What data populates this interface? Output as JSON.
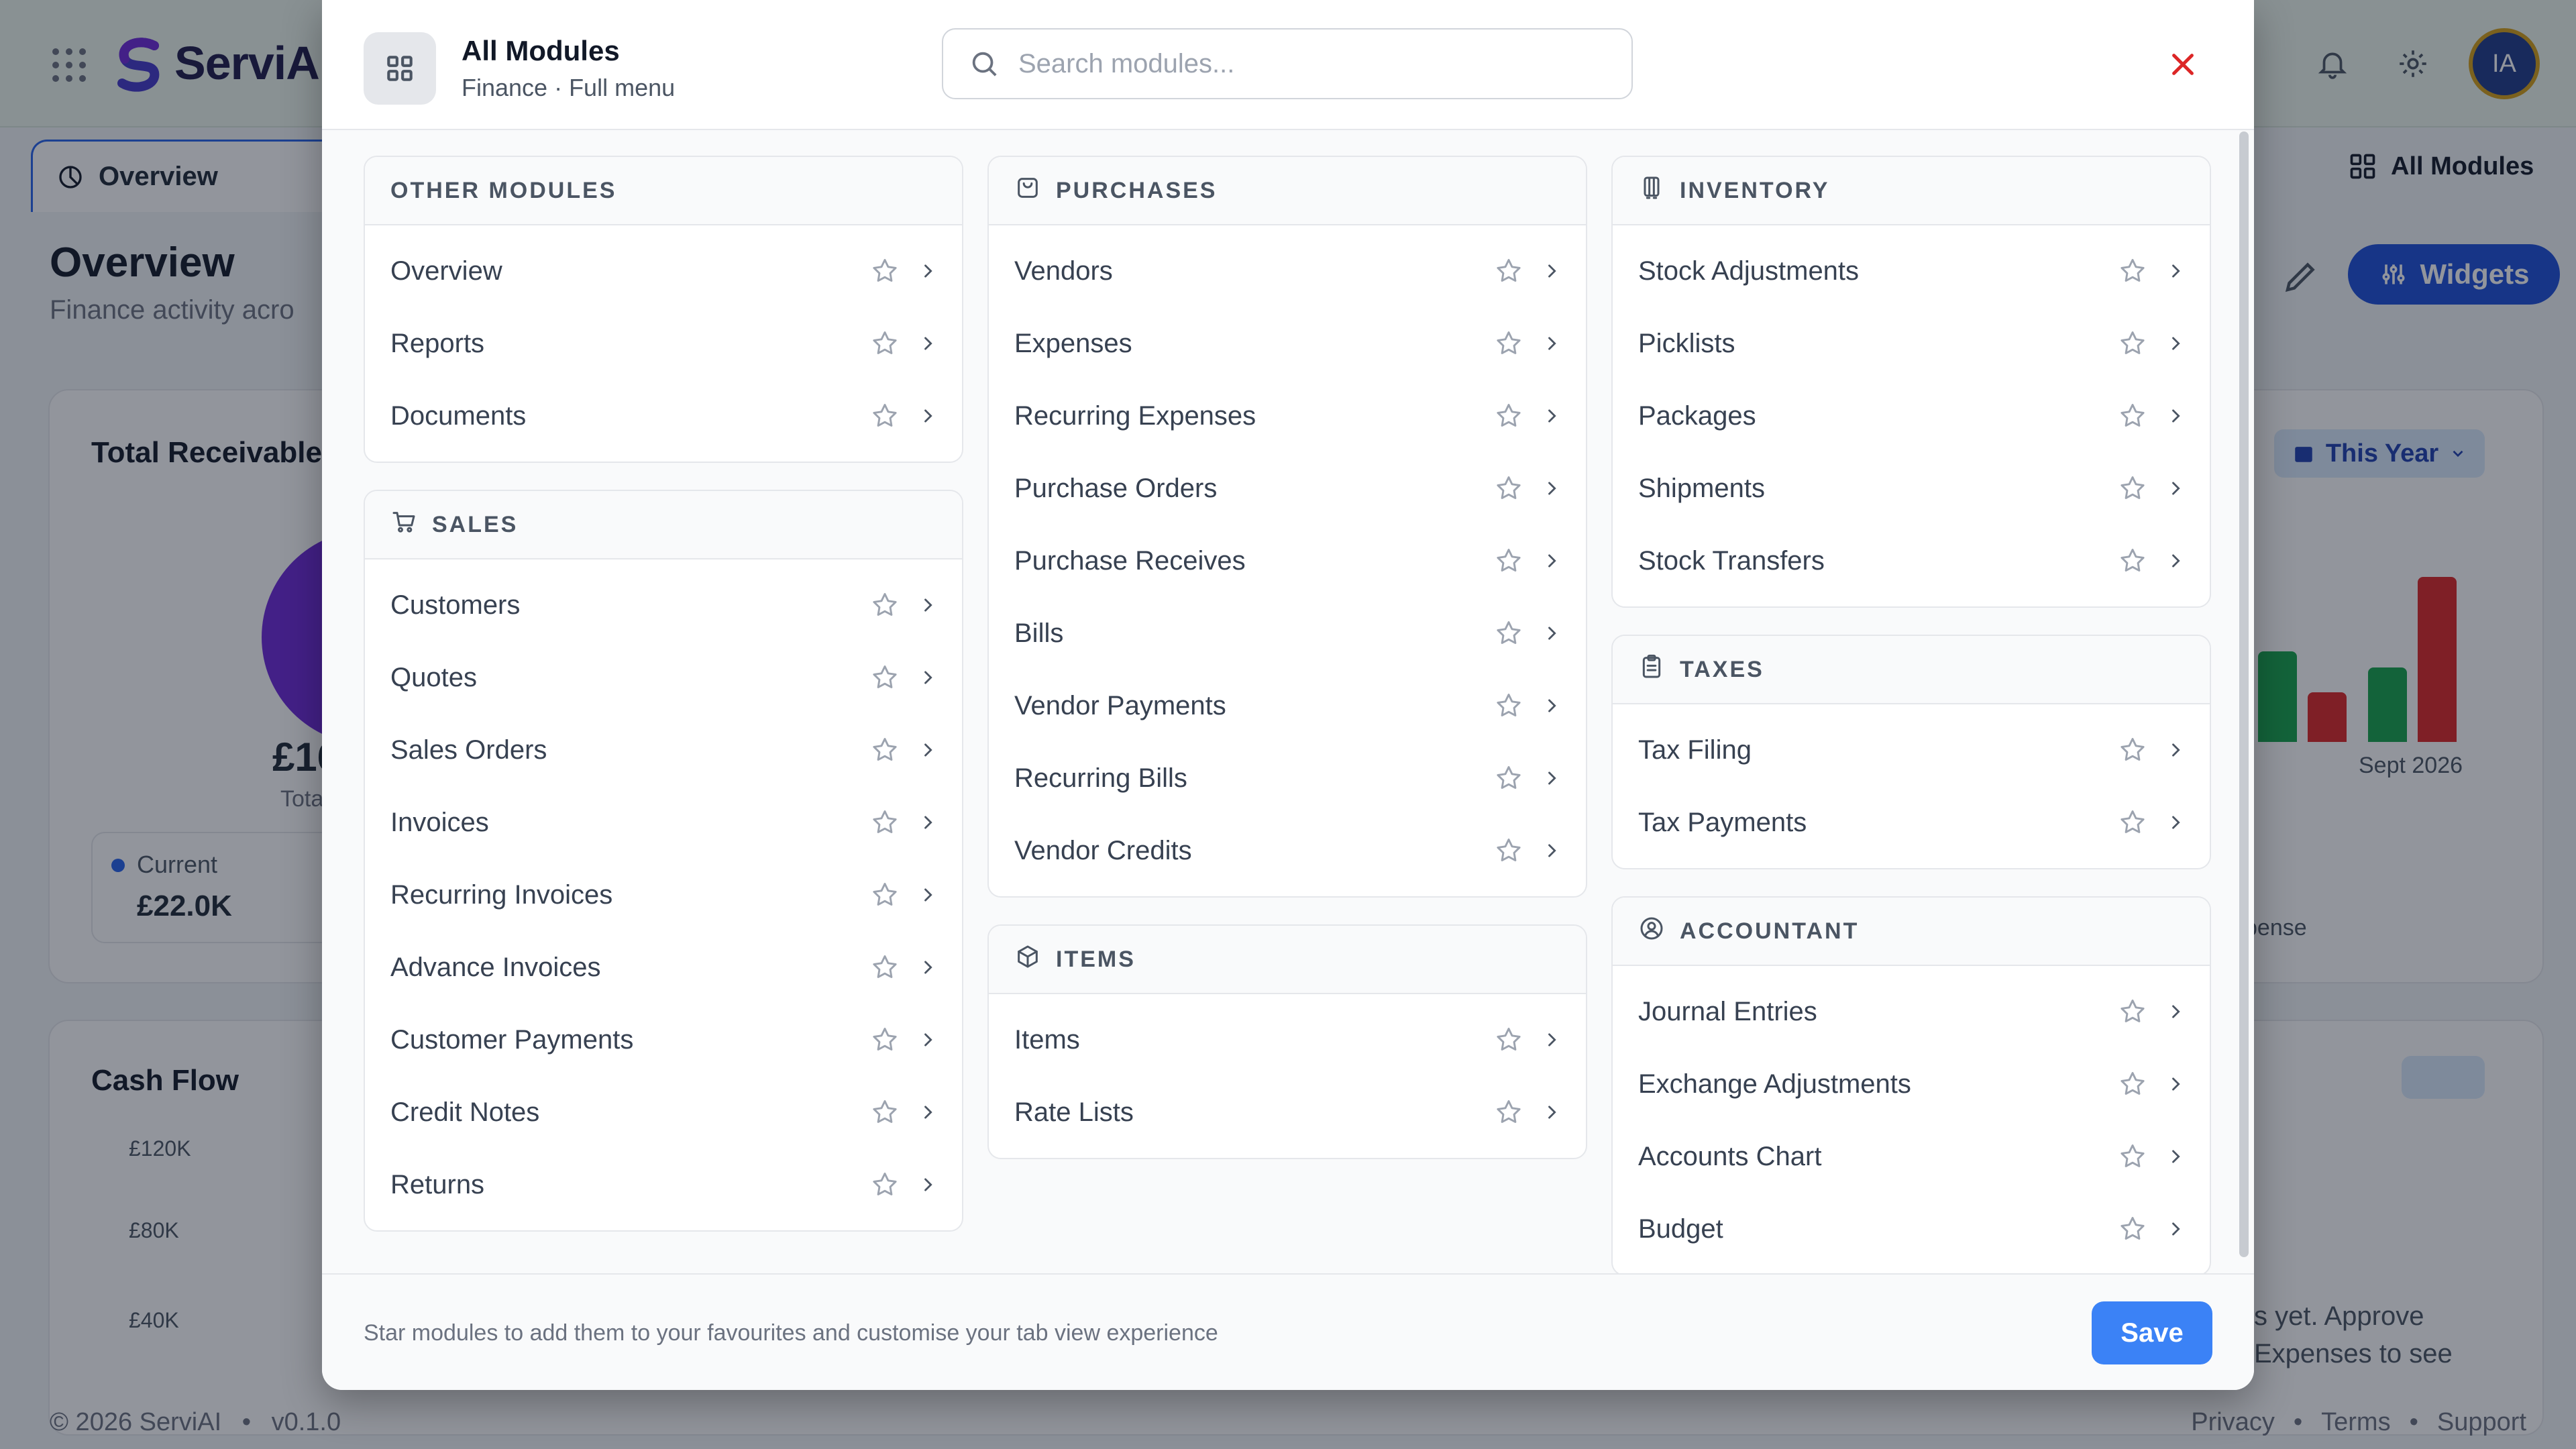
{
  "app": {
    "brand": "ServiAI",
    "avatar_initials": "IA"
  },
  "background": {
    "tab_overview": "Overview",
    "all_modules_tab": "All Modules",
    "page_title": "Overview",
    "page_subtitle": "Finance activity acro",
    "widgets_label": "Widgets",
    "card_receivables_title": "Total Receivables",
    "receivables_value_partial": "£16",
    "receivables_caption_partial": "Tota",
    "current_label": "Current",
    "current_value": "£22.0K",
    "year_filter": "This Year",
    "sept_label": "Sept 2026",
    "expense_partial": "pense",
    "cash_flow_title": "Cash Flow",
    "y_ticks": [
      "£120K",
      "£80K",
      "£40K"
    ],
    "empty_note_line1": "s yet. Approve",
    "empty_note_line2": "Expenses to see",
    "bars": [
      {
        "color": "#16a34a",
        "value": 0.55
      },
      {
        "color": "#dc2626",
        "value": 0.3
      },
      {
        "color": "#16a34a",
        "value": 0.45
      },
      {
        "color": "#dc2626",
        "value": 1.0
      }
    ]
  },
  "footer": {
    "copyright": "© 2026 ServiAI",
    "version": "v0.1.0",
    "links": [
      "Privacy",
      "Terms",
      "Support"
    ],
    "separator": "•"
  },
  "modal": {
    "title": "All Modules",
    "subtitle": "Finance · Full menu",
    "search_placeholder": "Search modules...",
    "footer_note": "Star modules to add them to your favourites and customise your tab view experience",
    "save_label": "Save",
    "columns": [
      [
        {
          "key": "other",
          "title": "OTHER MODULES",
          "icon": "none",
          "items": [
            "Overview",
            "Reports",
            "Documents"
          ]
        },
        {
          "key": "sales",
          "title": "SALES",
          "icon": "cart-icon",
          "items": [
            "Customers",
            "Quotes",
            "Sales Orders",
            "Invoices",
            "Recurring Invoices",
            "Advance Invoices",
            "Customer Payments",
            "Credit Notes",
            "Returns"
          ]
        }
      ],
      [
        {
          "key": "purchases",
          "title": "PURCHASES",
          "icon": "bag-icon",
          "items": [
            "Vendors",
            "Expenses",
            "Recurring Expenses",
            "Purchase Orders",
            "Purchase Receives",
            "Bills",
            "Vendor Payments",
            "Recurring Bills",
            "Vendor Credits"
          ]
        },
        {
          "key": "items",
          "title": "ITEMS",
          "icon": "box-icon",
          "items": [
            "Items",
            "Rate Lists"
          ]
        }
      ],
      [
        {
          "key": "inventory",
          "title": "INVENTORY",
          "icon": "cart-trolley-icon",
          "items": [
            "Stock Adjustments",
            "Picklists",
            "Packages",
            "Shipments",
            "Stock Transfers"
          ]
        },
        {
          "key": "taxes",
          "title": "TAXES",
          "icon": "clipboard-icon",
          "items": [
            "Tax Filing",
            "Tax Payments"
          ]
        },
        {
          "key": "accountant",
          "title": "ACCOUNTANT",
          "icon": "user-circle-icon",
          "items": [
            "Journal Entries",
            "Exchange Adjustments",
            "Accounts Chart",
            "Budget"
          ]
        }
      ]
    ]
  },
  "colors": {
    "accent": "#1d4ed8",
    "save": "#3b82f6",
    "close": "#dc2626",
    "star": "#9ca3af"
  }
}
